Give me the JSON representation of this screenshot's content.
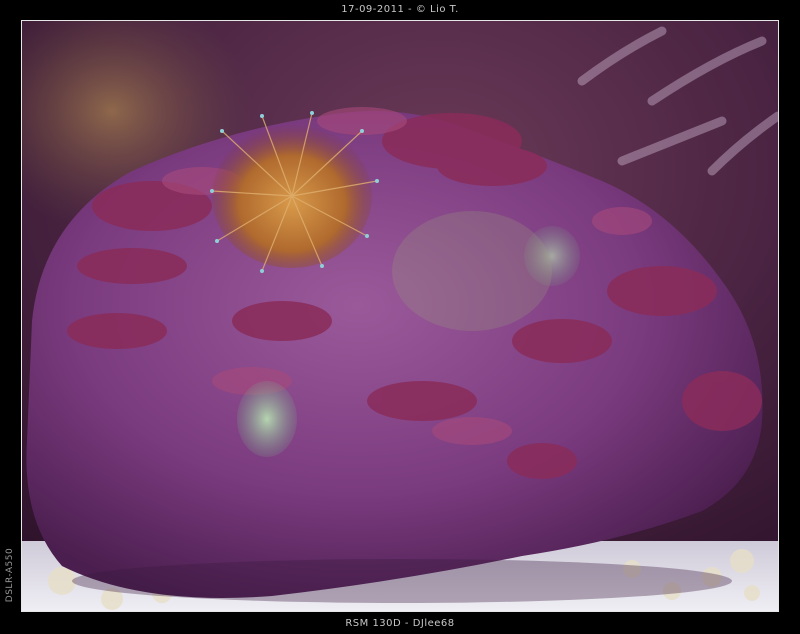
{
  "header": {
    "caption": "17-09-2011 - © Lio T."
  },
  "footer": {
    "caption": "RSM 130D - DJlee68"
  },
  "side": {
    "caption": "DSLR-A550"
  },
  "photo": {
    "subject": "coral-photo"
  }
}
